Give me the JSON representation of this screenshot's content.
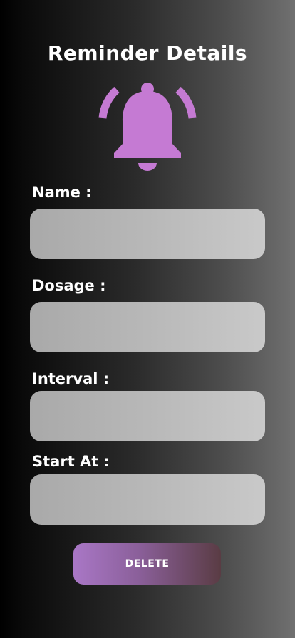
{
  "header": {
    "title": "Reminder Details",
    "icon": "bell-icon",
    "icon_color": "#c57ad3"
  },
  "form": {
    "fields": [
      {
        "label": "Name :",
        "value": ""
      },
      {
        "label": "Dosage :",
        "value": ""
      },
      {
        "label": "Interval :",
        "value": ""
      },
      {
        "label": "Start At :",
        "value": ""
      }
    ]
  },
  "actions": {
    "delete_label": "DELETE"
  }
}
